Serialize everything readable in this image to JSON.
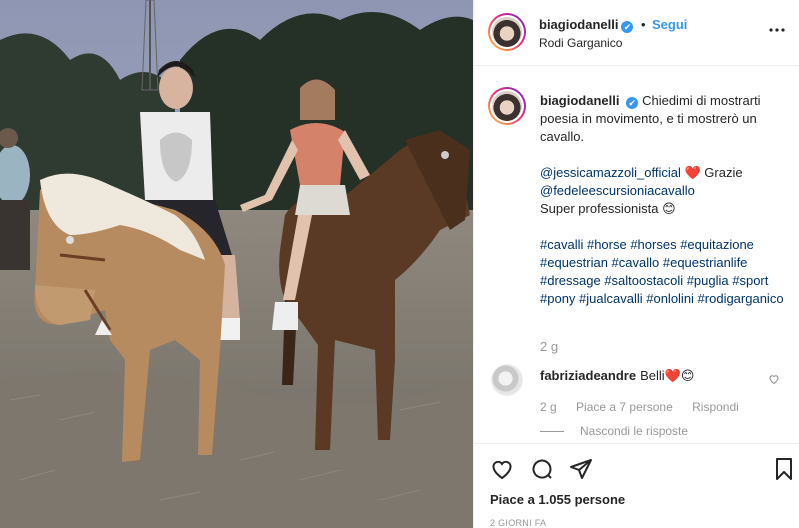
{
  "post": {
    "photo_alt": "Due persone a cavallo al tramonto"
  },
  "header": {
    "username": "biagiodanelli",
    "verified_mark": "✔",
    "separator": "•",
    "follow_label": "Segui",
    "location": "Rodi Garganico",
    "more_icon": "more-icon"
  },
  "caption": {
    "username": "biagiodanelli",
    "verified_mark": "✔",
    "lines": [
      "Chiedimi di mostrarti poesia in movimento, e ti mostrerò un cavallo.",
      "",
      "@jessicamazzoli_official",
      "❤️",
      "Grazie",
      "@fedeleescursioniacavallo",
      "Super professionista",
      "😊",
      "",
      "#cavalli #horse #horses #equitazione #equestrian #cavallo #equestrianlife #dressage #saltoostacoli #puglia #sport #pony #jualcavalli #onlolini #rodigarganico"
    ],
    "time": "2 g"
  },
  "comment": {
    "username": "fabriziadeandre",
    "text": "Belli",
    "emojis": "❤️😊",
    "time": "2 g",
    "likes_label": "Piace a 7 persone",
    "reply_label": "Rispondi",
    "hide_replies_label": "Nascondi le risposte",
    "like_icon": "heart-outline-icon"
  },
  "actions": {
    "like_icon": "heart-outline-icon",
    "comment_icon": "comment-icon",
    "share_icon": "share-icon",
    "save_icon": "bookmark-icon",
    "likes_label": "Piace a 1.055 persone",
    "age_label": "2 GIORNI FA"
  },
  "colors": {
    "accent": "#3897f0",
    "text": "#262626",
    "muted": "#999999",
    "mention": "#003569",
    "heart": "#ed4956"
  }
}
